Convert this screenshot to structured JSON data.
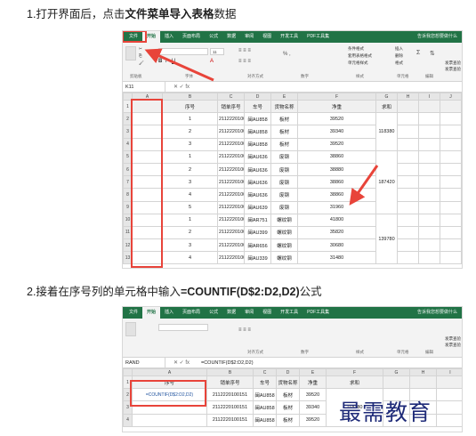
{
  "step1": {
    "text_a": "1.打开界面后，点击",
    "text_b": "文件菜单导入表格",
    "text_c": "数据"
  },
  "step2": {
    "text_a": "2.接着在序号列的单元格中输入",
    "text_b": "=COUNTIF(D$2:D2,D2)",
    "text_c": "公式"
  },
  "shot1": {
    "tabs": [
      "文件",
      "开始",
      "插入",
      "页面布局",
      "公式",
      "数据",
      "审阅",
      "视图",
      "开发工具",
      "PDF工具集",
      "告诉我您想要做什么"
    ],
    "ribbon": {
      "font_size": "11",
      "groups": [
        "剪贴板",
        "字体",
        "对齐方式",
        "数字",
        "样式",
        "单元格",
        "编辑"
      ],
      "style_items": [
        "条件格式",
        "套用表格格式",
        "单元格样式"
      ],
      "cell_items": [
        "插入",
        "删除",
        "格式"
      ],
      "share": "发票查验",
      "share2": "发票查验"
    },
    "namebox": "K11",
    "formula": "",
    "col_headers": [
      "A",
      "B",
      "C",
      "D",
      "E",
      "F",
      "G",
      "H",
      "I",
      "J"
    ],
    "headers": [
      "序号",
      "销单序号",
      "车号",
      "货物名称",
      "净重",
      "求和"
    ],
    "rows": [
      [
        "1",
        "2112220100151",
        "闽AU858",
        "板材",
        "39520"
      ],
      [
        "2",
        "2112220100151",
        "闽AU858",
        "板材",
        "39340"
      ],
      [
        "3",
        "2112220100151",
        "闽AU858",
        "板材",
        "39520"
      ],
      [
        "1",
        "2112220100110",
        "闽AU636",
        "废钢",
        "38860"
      ],
      [
        "2",
        "2112220100110",
        "闽AU636",
        "废钢",
        "38880"
      ],
      [
        "3",
        "2112220100110",
        "闽AU636",
        "废钢",
        "38860"
      ],
      [
        "4",
        "2112220100110",
        "闽AU636",
        "废钢",
        "38860"
      ],
      [
        "5",
        "2112220100132",
        "闽AU639",
        "废钢",
        "31960"
      ],
      [
        "1",
        "2112220100087",
        "闽AR751",
        "螺纹钢",
        "41800"
      ],
      [
        "2",
        "2112220100149",
        "闽AU399",
        "螺纹钢",
        "35820"
      ],
      [
        "3",
        "2112220100188",
        "闽AR656",
        "螺纹钢",
        "30680"
      ],
      [
        "4",
        "2112220100155",
        "闽AU339",
        "螺纹钢",
        "31480"
      ]
    ],
    "sums": [
      "118380",
      "187420",
      "139780"
    ]
  },
  "shot2": {
    "tabs": [
      "文件",
      "开始",
      "插入",
      "页面布局",
      "公式",
      "数据",
      "审阅",
      "视图",
      "开发工具",
      "PDF工具集",
      "告诉我您想要做什么"
    ],
    "title": "原始号_打个人物的新文件.xlsx - Excel",
    "namebox": "RAND",
    "formula": "=COUNTIF(D$2:D2,D2)",
    "ribbon_groups": [
      "对齐方式",
      "数字",
      "样式",
      "单元格",
      "编辑"
    ],
    "share": "发票查验",
    "share2": "发票查验",
    "col_headers": [
      "A",
      "B",
      "C",
      "D",
      "E",
      "F",
      "G",
      "H",
      "I"
    ],
    "headers": [
      "序号",
      "销单序号",
      "车号",
      "货物名称",
      "净重",
      "求和"
    ],
    "rows": [
      [
        "=COUNTIF(D$2:D2,D2)",
        "2112220100151",
        "闽AU858",
        "板材",
        "39520"
      ],
      [
        "",
        "2112220100151",
        "闽AU858",
        "板材",
        "39340"
      ],
      [
        "",
        "2112220100151",
        "闽AU858",
        "板材",
        "39520"
      ]
    ],
    "sum": "118380"
  },
  "watermark": "最需教育",
  "accent_red": "#e8443a",
  "excel_green": "#217346"
}
